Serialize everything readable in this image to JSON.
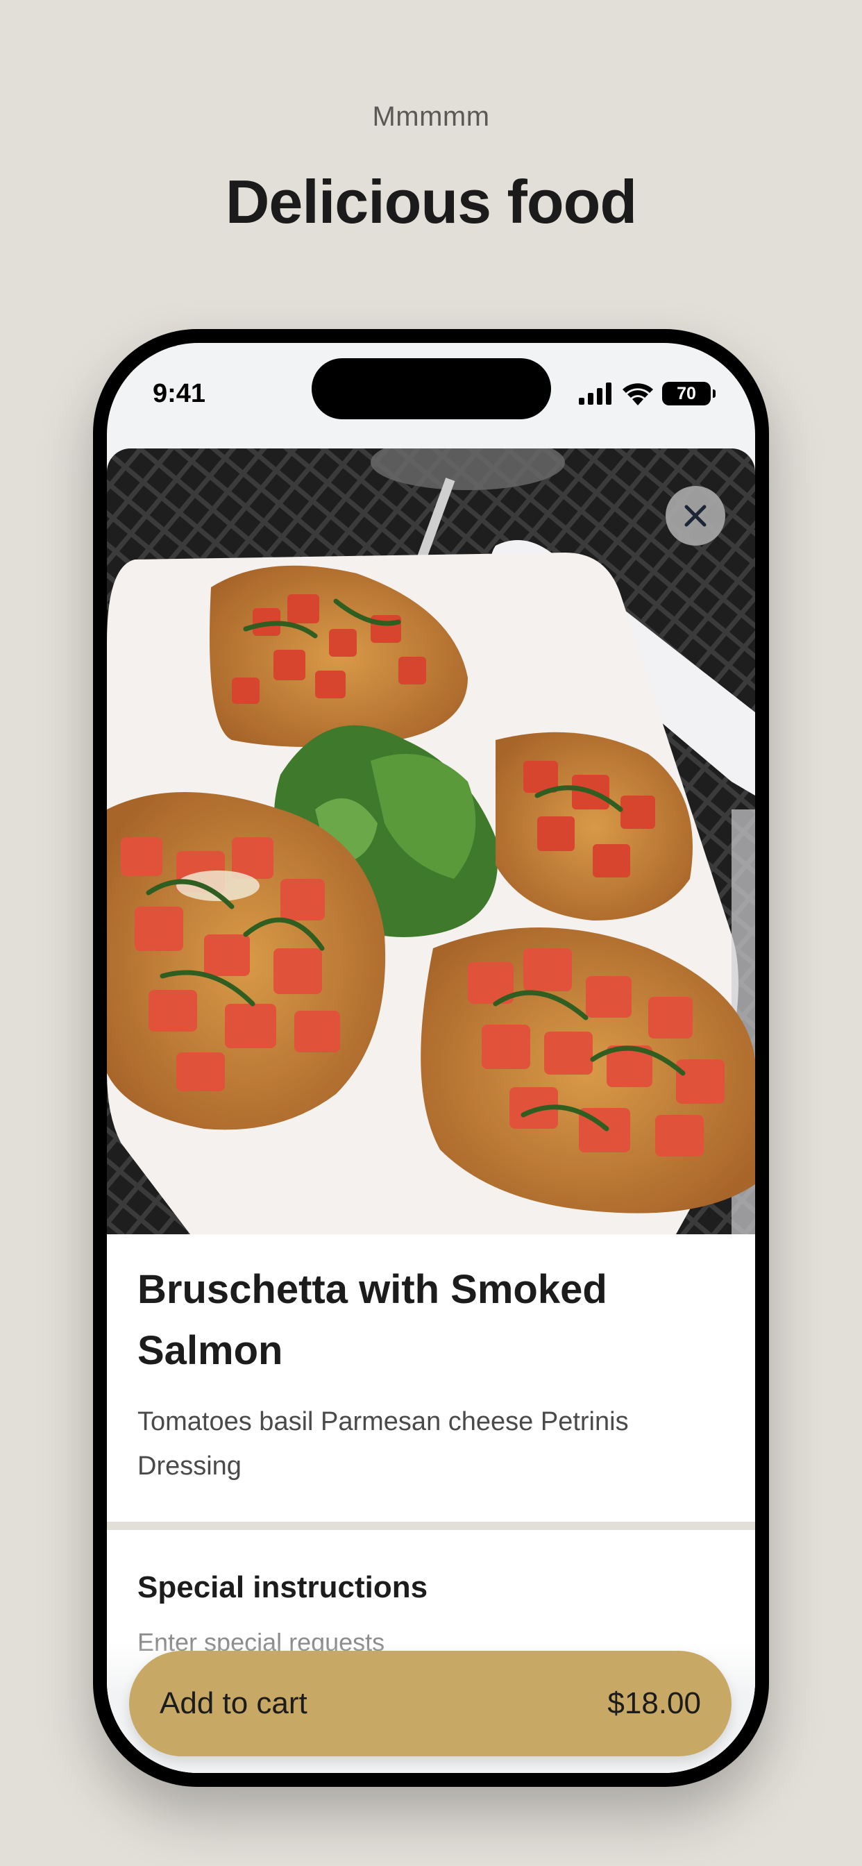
{
  "page": {
    "eyebrow": "Mmmmm",
    "headline": "Delicious food"
  },
  "status_bar": {
    "time": "9:41",
    "battery": "70",
    "icons": [
      "cellular-signal-icon",
      "wifi-icon",
      "battery-icon"
    ]
  },
  "item": {
    "image_icon": "food-photo",
    "close_icon": "close-icon",
    "title": "Bruschetta with Smoked Salmon",
    "description": "Tomatoes basil Parmesan cheese Petrinis Dressing"
  },
  "instructions": {
    "title": "Special instructions",
    "placeholder": "Enter special requests"
  },
  "cart": {
    "label": "Add to cart",
    "price": "$18.00"
  },
  "colors": {
    "background": "#e2dfd8",
    "accent": "#c8a865",
    "text": "#1c1c1c"
  }
}
